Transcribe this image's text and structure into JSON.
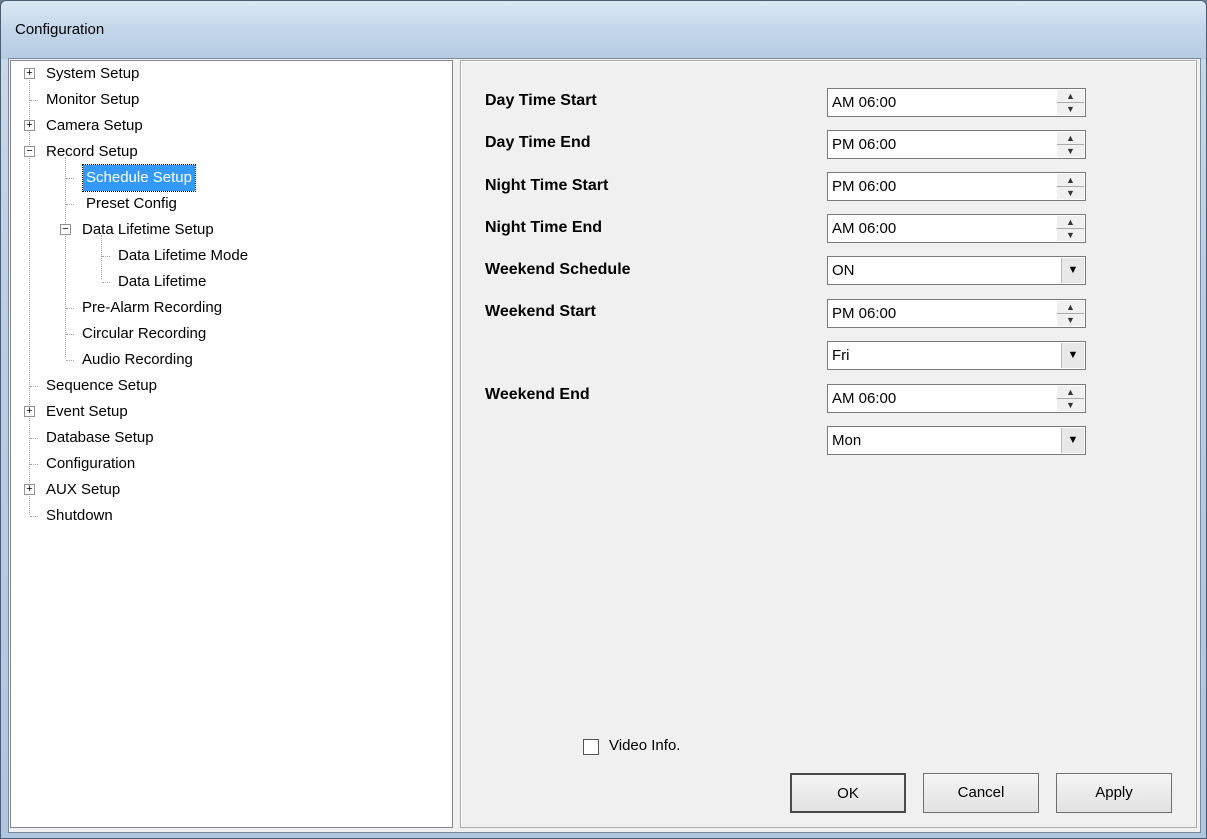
{
  "window": {
    "title": "Configuration"
  },
  "tree": {
    "items": [
      {
        "label": "System Setup",
        "expander": "+"
      },
      {
        "label": "Monitor Setup",
        "expander": ""
      },
      {
        "label": "Camera Setup",
        "expander": "+"
      },
      {
        "label": "Record Setup",
        "expander": "−"
      },
      {
        "label": "Schedule Setup",
        "expander": "",
        "selected": true
      },
      {
        "label": "Preset Config",
        "expander": ""
      },
      {
        "label": "Data Lifetime Setup",
        "expander": "−"
      },
      {
        "label": "Data Lifetime Mode",
        "expander": ""
      },
      {
        "label": "Data Lifetime",
        "expander": ""
      },
      {
        "label": "Pre-Alarm Recording",
        "expander": ""
      },
      {
        "label": "Circular Recording",
        "expander": ""
      },
      {
        "label": "Audio Recording",
        "expander": ""
      },
      {
        "label": "Sequence Setup",
        "expander": ""
      },
      {
        "label": "Event Setup",
        "expander": "+"
      },
      {
        "label": "Database Setup",
        "expander": ""
      },
      {
        "label": "Configuration",
        "expander": ""
      },
      {
        "label": "AUX Setup",
        "expander": "+"
      },
      {
        "label": "Shutdown",
        "expander": ""
      }
    ]
  },
  "form": {
    "day_time_start": {
      "label": "Day Time Start",
      "value": "AM 06:00"
    },
    "day_time_end": {
      "label": "Day Time End",
      "value": "PM 06:00"
    },
    "night_time_start": {
      "label": "Night Time Start",
      "value": "PM 06:00"
    },
    "night_time_end": {
      "label": "Night Time End",
      "value": "AM 06:00"
    },
    "weekend_schedule": {
      "label": "Weekend Schedule",
      "value": "ON"
    },
    "weekend_start": {
      "label": "Weekend Start",
      "value": "PM 06:00",
      "day": "Fri"
    },
    "weekend_end": {
      "label": "Weekend End",
      "value": "AM 06:00",
      "day": "Mon"
    }
  },
  "video_info": {
    "label": "Video Info.",
    "checked": false
  },
  "buttons": {
    "ok": "OK",
    "cancel": "Cancel",
    "apply": "Apply"
  }
}
